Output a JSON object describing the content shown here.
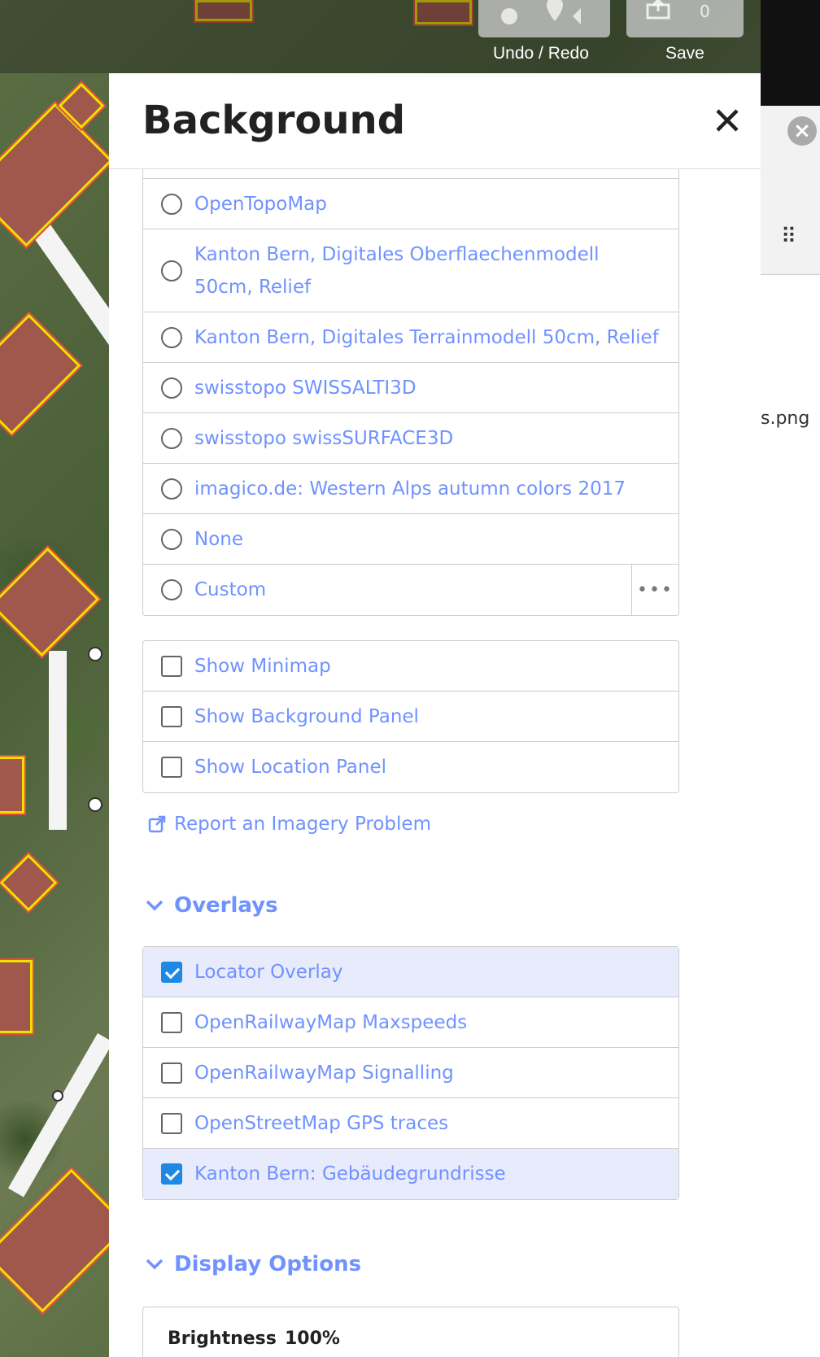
{
  "toolbar": {
    "undo_redo_label": "Undo / Redo",
    "save_label": "Save",
    "save_count": "0"
  },
  "pane": {
    "title": "Background"
  },
  "background_sources": [
    {
      "label": "OpenTopoMap",
      "selected": false
    },
    {
      "label": "Kanton Bern, Digitales Oberflaechenmodell 50cm, Relief",
      "selected": false
    },
    {
      "label": "Kanton Bern, Digitales Terrainmodell 50cm, Relief",
      "selected": false
    },
    {
      "label": "swisstopo SWISSALTI3D",
      "selected": false
    },
    {
      "label": "swisstopo swissSURFACE3D",
      "selected": false
    },
    {
      "label": "imagico.de: Western Alps autumn colors 2017",
      "selected": false
    },
    {
      "label": "None",
      "selected": false
    },
    {
      "label": "Custom",
      "selected": false
    }
  ],
  "background_options": [
    {
      "label": "Show Minimap",
      "checked": false
    },
    {
      "label": "Show Background Panel",
      "checked": false
    },
    {
      "label": "Show Location Panel",
      "checked": false
    }
  ],
  "report_link": "Report an Imagery Problem",
  "overlays": {
    "heading": "Overlays",
    "items": [
      {
        "label": "Locator Overlay",
        "checked": true
      },
      {
        "label": "OpenRailwayMap Maxspeeds",
        "checked": false
      },
      {
        "label": "OpenRailwayMap Signalling",
        "checked": false
      },
      {
        "label": "OpenStreetMap GPS traces",
        "checked": false
      },
      {
        "label": "Kanton Bern: Gebäudegrundrisse",
        "checked": true
      }
    ]
  },
  "display_options": {
    "heading": "Display Options",
    "brightness_label": "Brightness",
    "brightness_value": "100%"
  },
  "side_panel": {
    "file_text": "s.png"
  },
  "colors": {
    "accent": "#7092ff",
    "checkbox_on": "#1e88e5",
    "selected_row": "#e8ebfb",
    "controls_bg": "#646464"
  }
}
